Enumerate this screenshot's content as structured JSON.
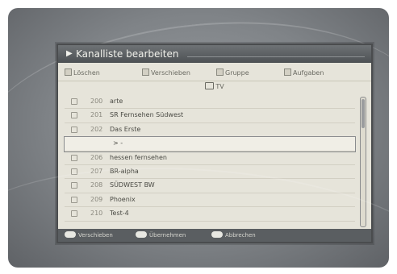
{
  "window": {
    "title": "Kanalliste bearbeiten"
  },
  "options": [
    {
      "label": "Löschen"
    },
    {
      "label": "Verschieben"
    },
    {
      "label": "Gruppe"
    },
    {
      "label": "Aufgaben"
    }
  ],
  "group": {
    "label": "TV"
  },
  "channels": [
    {
      "number": "200",
      "name": "arte"
    },
    {
      "number": "201",
      "name": "SR Fernsehen Südwest"
    },
    {
      "number": "202",
      "name": "Das Erste"
    },
    {
      "number": "",
      "name": "> -"
    },
    {
      "number": "206",
      "name": "hessen fernsehen"
    },
    {
      "number": "207",
      "name": "BR-alpha"
    },
    {
      "number": "208",
      "name": "SÜDWEST BW"
    },
    {
      "number": "209",
      "name": "Phoenix"
    },
    {
      "number": "210",
      "name": "Test-4"
    }
  ],
  "footer": {
    "items": [
      {
        "label": "Verschieben"
      },
      {
        "label": "Übernehmen"
      },
      {
        "label": "Abbrechen"
      }
    ]
  }
}
